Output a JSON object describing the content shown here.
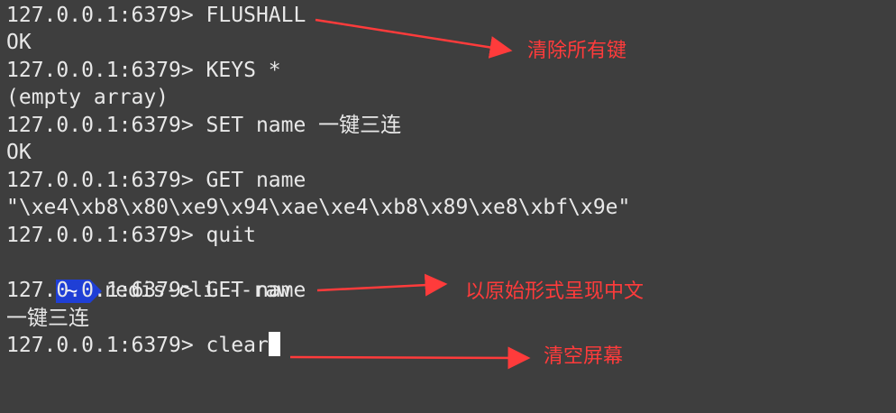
{
  "terminal": {
    "lines": [
      "127.0.0.1:6379> FLUSHALL",
      "OK",
      "127.0.0.1:6379> KEYS *",
      "(empty array)",
      "127.0.0.1:6379> SET name 一键三连",
      "OK",
      "127.0.0.1:6379> GET name",
      "\"\\xe4\\xb8\\x80\\xe9\\x94\\xae\\xe4\\xb8\\x89\\xe8\\xbf\\x9e\"",
      "127.0.0.1:6379> quit"
    ],
    "shell_prompt": {
      "badge": "~",
      "command": "redis-cli --raw"
    },
    "after_lines": [
      "127.0.0.1:6379> GET name",
      "一键三连"
    ],
    "current_input": "127.0.0.1:6379> clear"
  },
  "annotations": {
    "flushall_note": "清除所有键",
    "raw_note": "以原始形式呈现中文",
    "clear_note": "清空屏幕"
  },
  "colors": {
    "background": "#3e3e3e",
    "text": "#e8e8e8",
    "prompt_badge": "#1f3fd6",
    "annotation": "#ff3b3b"
  }
}
